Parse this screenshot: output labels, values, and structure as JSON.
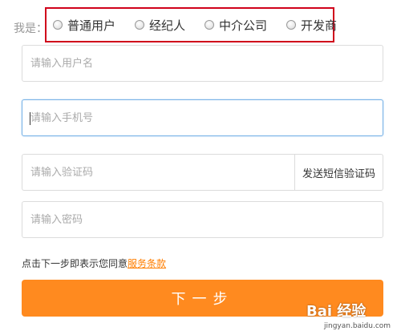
{
  "role": {
    "label": "我是：",
    "options": [
      {
        "label": "普通用户"
      },
      {
        "label": "经纪人"
      },
      {
        "label": "中介公司"
      },
      {
        "label": "开发商"
      }
    ]
  },
  "form": {
    "username_placeholder": "请输入用户名",
    "phone_placeholder": "请输入手机号",
    "code_placeholder": "请输入验证码",
    "send_code_label": "发送短信验证码",
    "password_placeholder": "请输入密码"
  },
  "agreement": {
    "text": "点击下一步即表示您同意",
    "link_label": "服务条款"
  },
  "next_label": "下一步",
  "watermark": {
    "brand": "Bai 经验",
    "url": "jingyan.baidu.com"
  },
  "colors": {
    "accent": "#ff8a1f",
    "highlight_box": "#d0021b",
    "focus_border": "#77b2e6"
  }
}
